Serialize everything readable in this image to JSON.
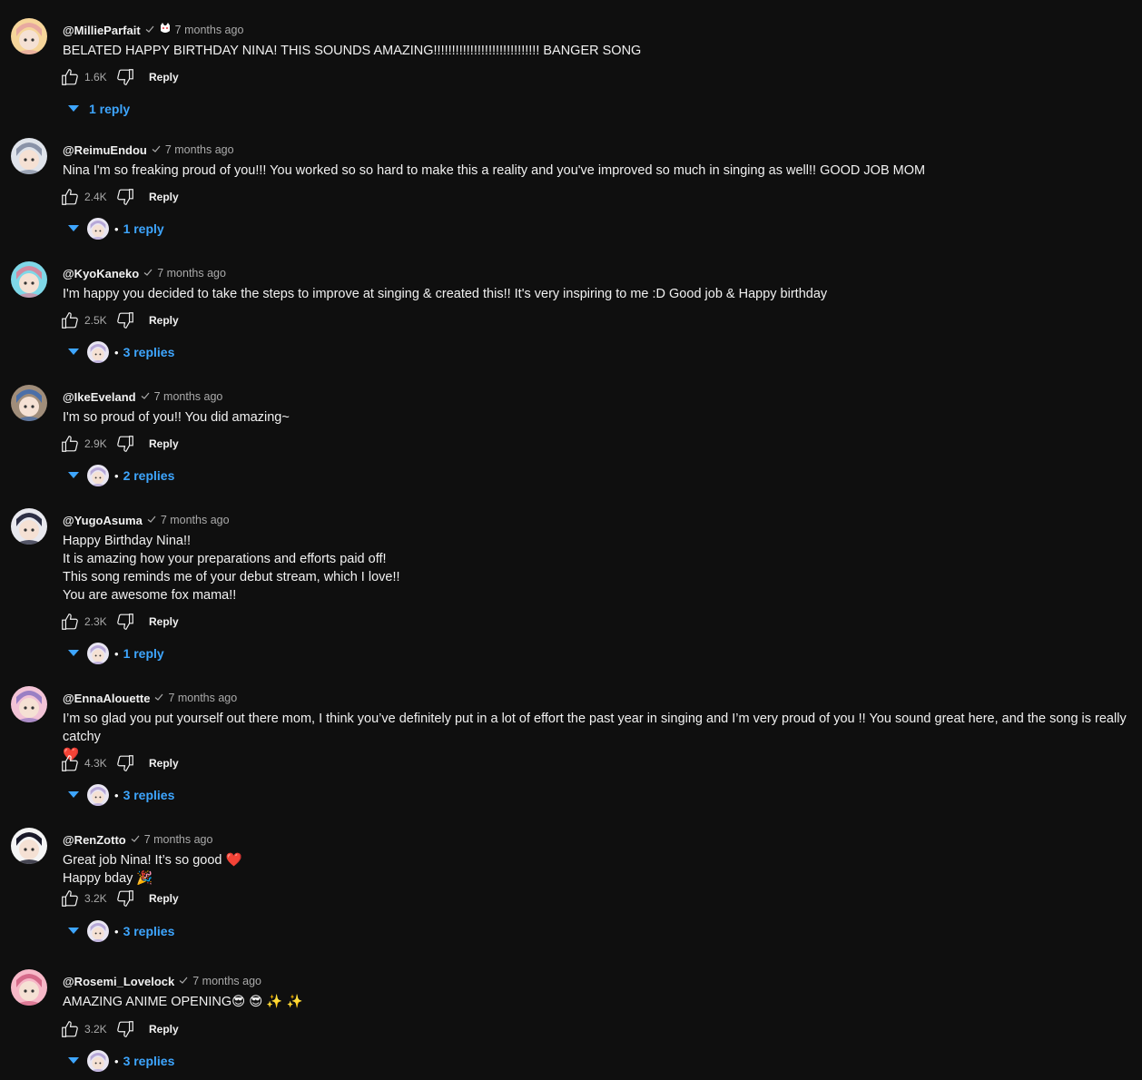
{
  "colors": {
    "background": "#0f0f0f",
    "text": "#f1f1f1",
    "muted": "#aaaaaa",
    "link": "#3ea6ff",
    "heart": "#e8333a"
  },
  "reply_label": "Reply",
  "comments": [
    {
      "author": "@MillieParfait",
      "time": "7 months ago",
      "badge": "cat-emoji-icon",
      "lines": [
        "BELATED HAPPY BIRTHDAY NINA! THIS SOUNDS AMAZING!!!!!!!!!!!!!!!!!!!!!!!!!!!!! BANGER SONG"
      ],
      "likes": "1.6K",
      "replies": "1 reply",
      "reply_avatar": false,
      "avatar_colors": [
        "#f6d59a",
        "#e8a9a0"
      ]
    },
    {
      "author": "@ReimuEndou",
      "time": "7 months ago",
      "lines": [
        "Nina I'm so freaking proud of you!!! You worked so so hard to make this a reality and you've improved so much in singing as well!! GOOD JOB MOM"
      ],
      "likes": "2.4K",
      "replies": "1 reply",
      "reply_avatar": true,
      "avatar_colors": [
        "#dfe3ea",
        "#8a93a8"
      ]
    },
    {
      "author": "@KyoKaneko",
      "time": "7 months ago",
      "lines": [
        "I'm happy you decided to take the steps to improve at singing  & created this!! It's very inspiring to me :D Good job & Happy birthday"
      ],
      "likes": "2.5K",
      "replies": "3 replies",
      "reply_avatar": true,
      "avatar_colors": [
        "#7fd8e8",
        "#d28aa0"
      ]
    },
    {
      "author": "@IkeEveland",
      "time": "7 months ago",
      "lines": [
        "I'm so proud of you!! You did amazing~"
      ],
      "likes": "2.9K",
      "replies": "2 replies",
      "reply_avatar": true,
      "avatar_colors": [
        "#a08d7a",
        "#4b6fa8"
      ]
    },
    {
      "author": "@YugoAsuma",
      "time": "7 months ago",
      "lines": [
        "Happy Birthday Nina!!",
        "It is amazing how your preparations and efforts paid off!",
        "This song reminds me of your debut stream, which I love!!",
        "You are awesome fox mama!!"
      ],
      "likes": "2.3K",
      "replies": "1 reply",
      "reply_avatar": true,
      "avatar_colors": [
        "#e8e8ee",
        "#2d2f45"
      ]
    },
    {
      "author": "@EnnaAlouette",
      "time": "7 months ago",
      "lines": [
        "I’m so glad you put yourself out there mom, I think you’ve definitely put in a lot of effort the past year in singing and I’m very proud of you !! You sound great here, and the song is really catchy",
        "❤️"
      ],
      "likes": "4.3K",
      "replies": "3 replies",
      "reply_avatar": true,
      "avatar_colors": [
        "#f2c3d6",
        "#9a7fc4"
      ]
    },
    {
      "author": "@RenZotto",
      "time": "7 months ago",
      "lines": [
        "Great job Nina! It’s so good ❤️",
        "Happy bday 🎉"
      ],
      "likes": "3.2K",
      "replies": "3 replies",
      "reply_avatar": true,
      "avatar_colors": [
        "#f4f4f4",
        "#1a1a2a"
      ]
    },
    {
      "author": "@Rosemi_Lovelock",
      "time": "7 months ago",
      "lines": [
        "AMAZING ANIME OPENING😎 😎 ✨ ✨"
      ],
      "likes": "3.2K",
      "replies": "3 replies",
      "reply_avatar": true,
      "avatar_colors": [
        "#f7b8c8",
        "#d66a8a"
      ]
    }
  ]
}
